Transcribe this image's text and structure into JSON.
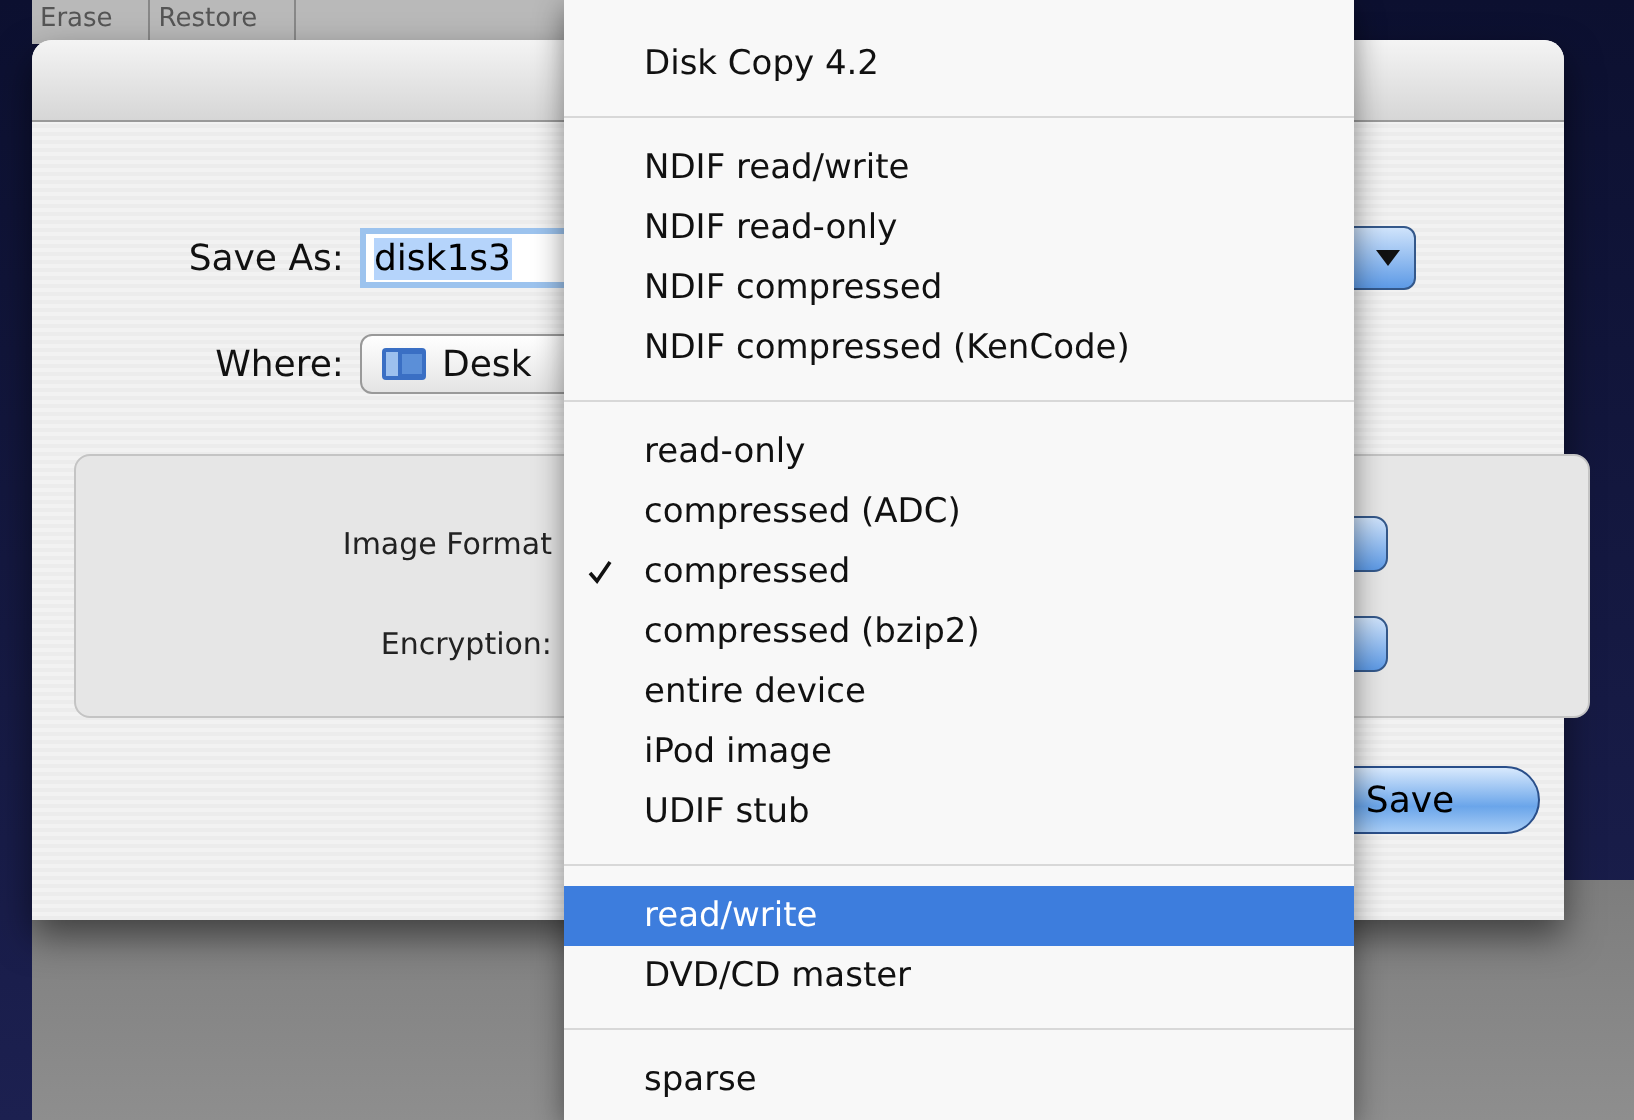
{
  "background_tabs": [
    {
      "label": "Erase"
    },
    {
      "label": "Restore"
    }
  ],
  "dialog": {
    "save_as": {
      "label": "Save As:",
      "value": "disk1s3"
    },
    "where": {
      "label": "Where:",
      "value": "Desk"
    },
    "options": [
      {
        "label": "Image Format"
      },
      {
        "label": "Encryption:"
      }
    ],
    "buttons": [
      {
        "label": "Save",
        "default": true
      }
    ]
  },
  "menu": {
    "groups": [
      [
        {
          "label": "Disk Copy 4.2",
          "checked": false,
          "selected": false
        }
      ],
      [
        {
          "label": "NDIF read/write",
          "checked": false,
          "selected": false
        },
        {
          "label": "NDIF read-only",
          "checked": false,
          "selected": false
        },
        {
          "label": "NDIF compressed",
          "checked": false,
          "selected": false
        },
        {
          "label": "NDIF compressed (KenCode)",
          "checked": false,
          "selected": false
        }
      ],
      [
        {
          "label": "read-only",
          "checked": false,
          "selected": false
        },
        {
          "label": "compressed (ADC)",
          "checked": false,
          "selected": false
        },
        {
          "label": "compressed",
          "checked": true,
          "selected": false
        },
        {
          "label": "compressed (bzip2)",
          "checked": false,
          "selected": false
        },
        {
          "label": "entire device",
          "checked": false,
          "selected": false
        },
        {
          "label": "iPod image",
          "checked": false,
          "selected": false
        },
        {
          "label": "UDIF stub",
          "checked": false,
          "selected": false
        }
      ],
      [
        {
          "label": "read/write",
          "checked": false,
          "selected": true
        },
        {
          "label": "DVD/CD master",
          "checked": false,
          "selected": false
        }
      ],
      [
        {
          "label": "sparse",
          "checked": false,
          "selected": false
        }
      ]
    ]
  }
}
